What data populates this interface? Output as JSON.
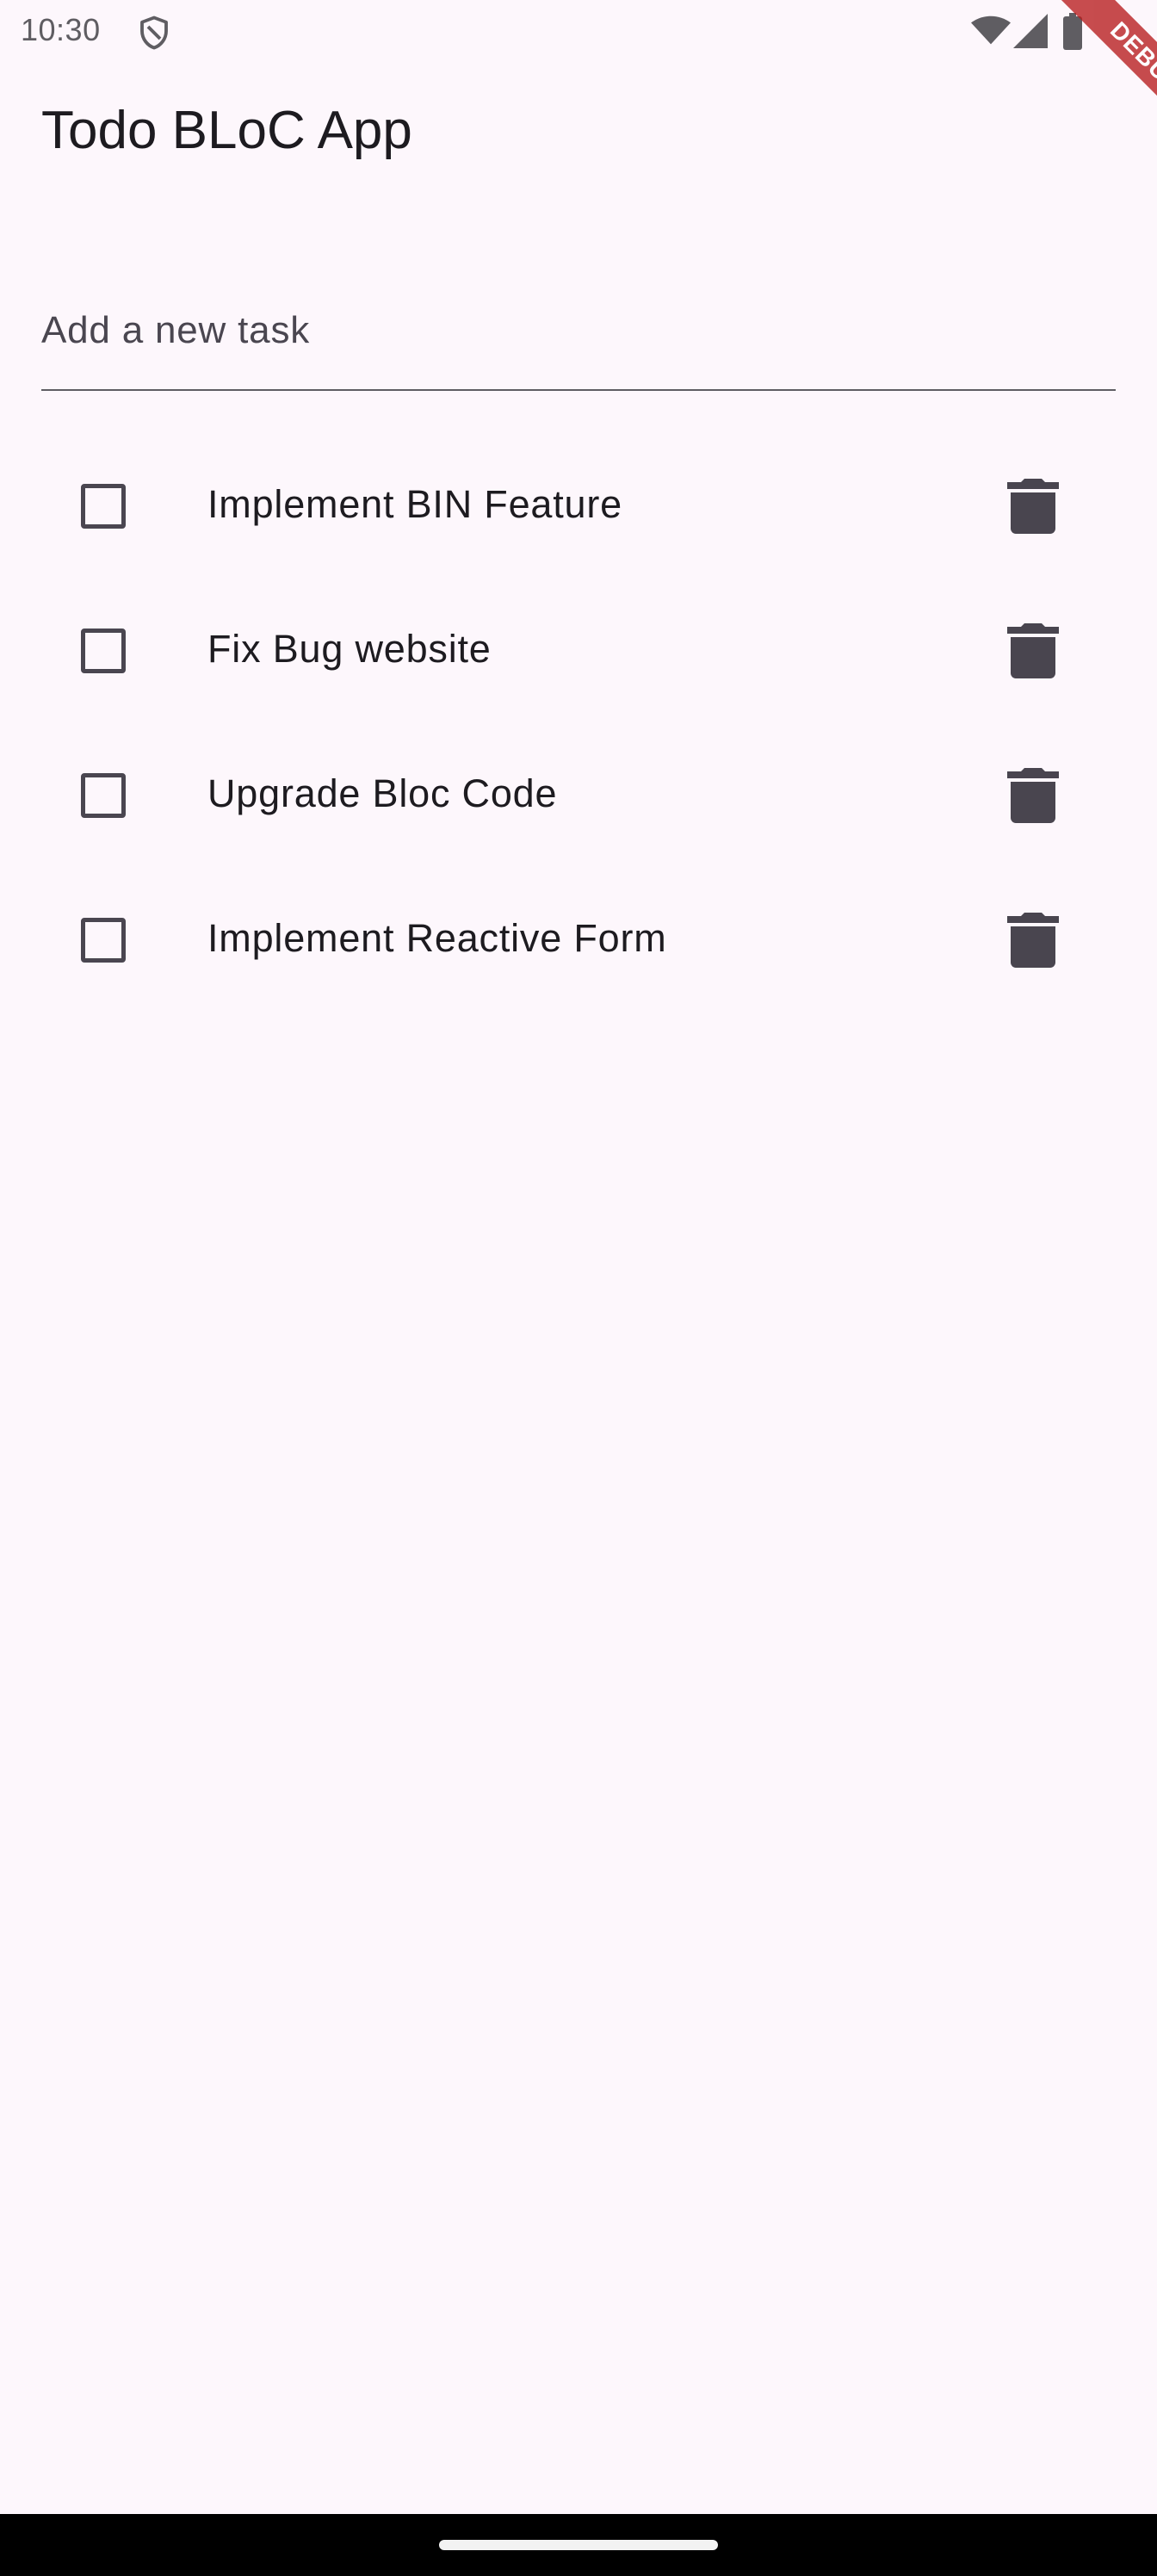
{
  "status_bar": {
    "time": "10:30",
    "icons": [
      "shield-icon",
      "wifi-icon",
      "signal-icon",
      "battery-icon"
    ]
  },
  "debug_banner": {
    "label": "DEBUG",
    "color": "#b71c1c"
  },
  "app_bar": {
    "title": "Todo BLoC App"
  },
  "new_task": {
    "placeholder": "Add a new task",
    "value": ""
  },
  "todos": [
    {
      "label": "Implement BIN Feature",
      "done": false,
      "delete_icon": "trash-icon"
    },
    {
      "label": "Fix Bug website",
      "done": false,
      "delete_icon": "trash-icon"
    },
    {
      "label": "Upgrade Bloc Code",
      "done": false,
      "delete_icon": "trash-icon"
    },
    {
      "label": "Implement Reactive Form",
      "done": false,
      "delete_icon": "trash-icon"
    }
  ],
  "colors": {
    "background": "#fdf7fc",
    "text": "#1d1b20",
    "icon": "#49454f",
    "navigation_bar": "#000000"
  }
}
